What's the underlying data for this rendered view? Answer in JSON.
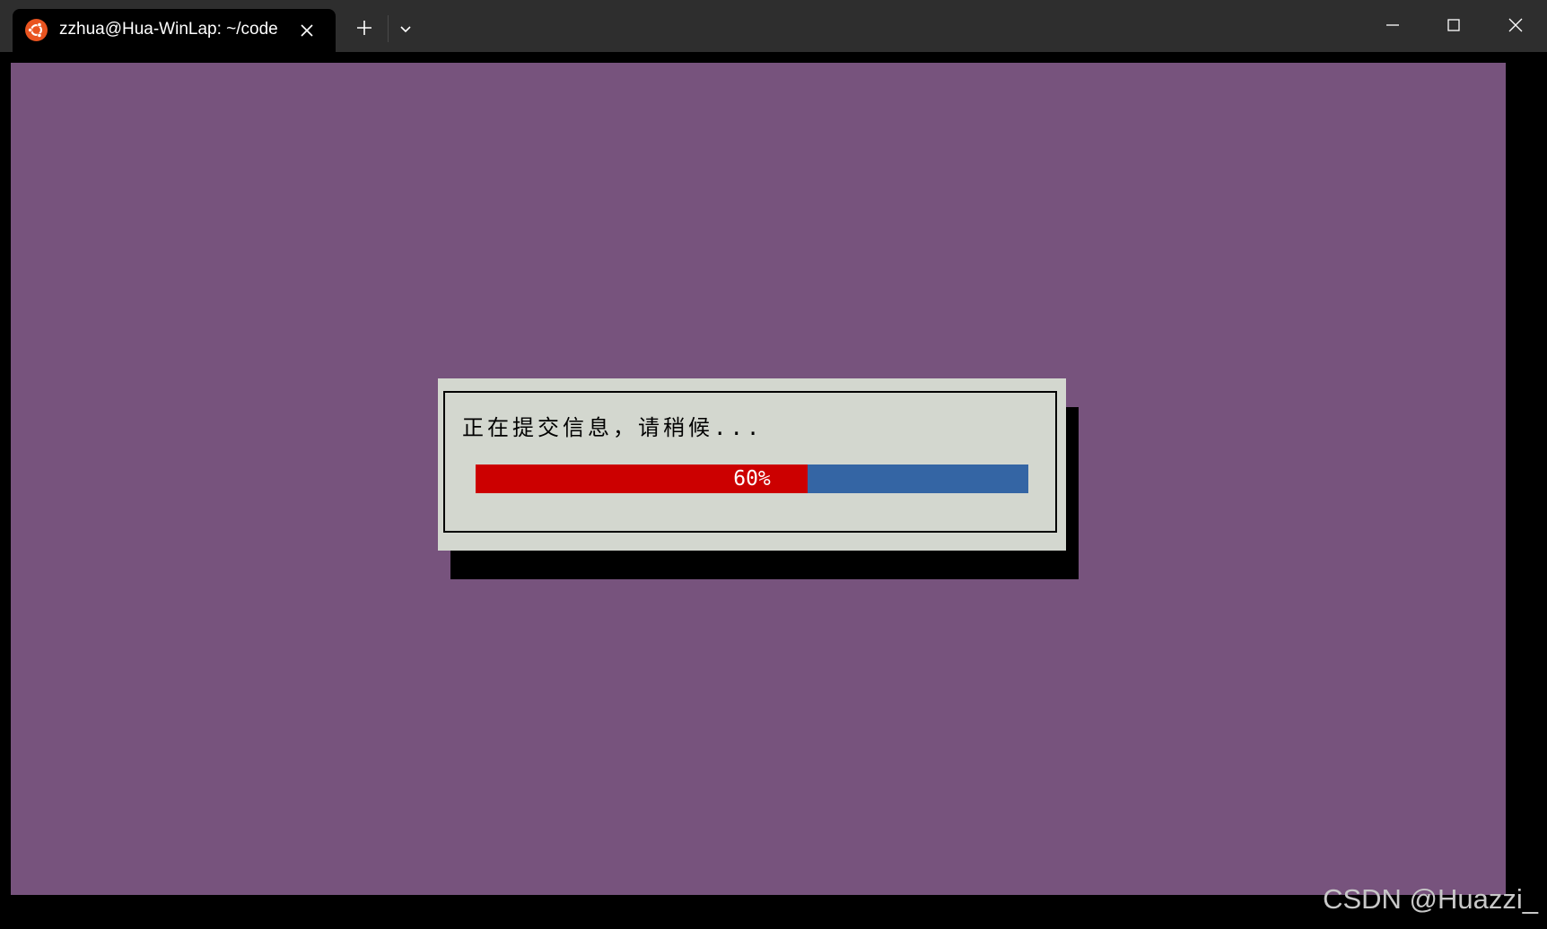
{
  "window": {
    "tab_title": "zzhua@Hua-WinLap: ~/code",
    "tab_icon": "ubuntu-icon",
    "new_tab_icon": "plus-icon",
    "dropdown_icon": "chevron-down-icon",
    "controls": [
      "minimize-icon",
      "maximize-icon",
      "close-icon"
    ]
  },
  "dialog": {
    "message": "正在提交信息，请稍候...",
    "progress": {
      "percent": 60,
      "label": "60%"
    }
  },
  "colors": {
    "terminal_background": "#77537d",
    "dialog_background": "#d3d7cf",
    "progress_done": "#cc0000",
    "progress_remaining": "#3465a4",
    "ubuntu_orange": "#e95420"
  },
  "watermark": "CSDN @Huazzi_"
}
